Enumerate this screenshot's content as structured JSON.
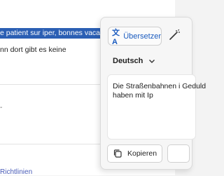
{
  "document": {
    "selected_text": "e patient sur iper, bonnes vacances",
    "line2": "nn dort gibt es keine",
    "stub_text": "-",
    "footer_link": "Richtlinien"
  },
  "translator": {
    "tab_label": "Übersetzer",
    "tab_icon": "translate-icon",
    "second_tab_icon": "magic-wand-icon",
    "target_language": "Deutsch",
    "language_chevron_icon": "chevron-down-icon",
    "output_text": "Die Straßenbahnen i Geduld haben mit Ip",
    "copy_label": "Kopieren",
    "copy_icon": "copy-icon",
    "accent_color": "#1a5bbf"
  }
}
